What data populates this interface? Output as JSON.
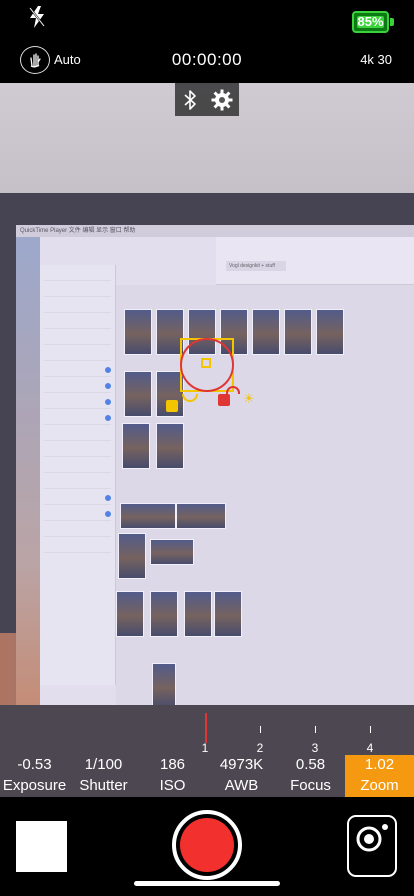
{
  "top": {
    "battery_percent": "85%",
    "stabilization_mode": "Auto",
    "timer": "00:00:00",
    "resolution": "4k 30"
  },
  "overlay": {
    "bluetooth_icon": "bluetooth-icon",
    "settings_icon": "gear-icon"
  },
  "screen": {
    "menubar_text": "QuickTime Player  文件  编辑  显示  窗口  帮助",
    "browser_tab": "Vogl  designkit + stuff",
    "colors": {
      "accent": "#f59a10",
      "record": "#f2312e",
      "focus": "#f3c400"
    }
  },
  "dial": {
    "ticks": [
      "1",
      "2",
      "3",
      "4"
    ]
  },
  "params": [
    {
      "value": "-0.53",
      "label": "Exposure"
    },
    {
      "value": "1/100",
      "label": "Shutter"
    },
    {
      "value": "186",
      "label": "ISO"
    },
    {
      "value": "4973K",
      "label": "AWB"
    },
    {
      "value": "0.58",
      "label": "Focus"
    },
    {
      "value": "1.02",
      "label": "Zoom"
    }
  ]
}
